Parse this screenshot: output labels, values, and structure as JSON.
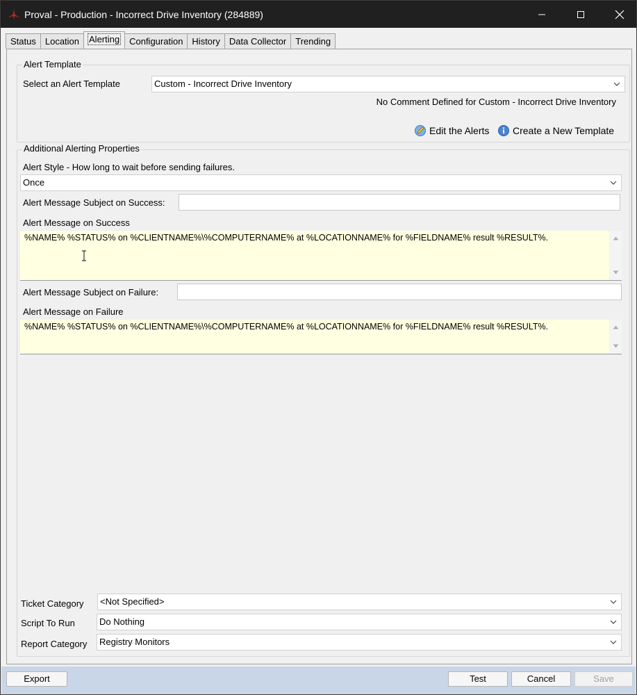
{
  "window": {
    "title": "Proval - Production - Incorrect Drive Inventory (284889)",
    "accent": "#c0281c"
  },
  "tabs": [
    {
      "label": "Status"
    },
    {
      "label": "Location"
    },
    {
      "label": "Alerting",
      "active": true
    },
    {
      "label": "Configuration"
    },
    {
      "label": "History"
    },
    {
      "label": "Data Collector"
    },
    {
      "label": "Trending"
    }
  ],
  "alert_template": {
    "group_label": "Alert Template",
    "select_label": "Select an Alert Template",
    "selected": "Custom - Incorrect Drive Inventory",
    "comment": "No Comment Defined for Custom - Incorrect Drive Inventory",
    "edit_alerts": "Edit the Alerts",
    "create_template": "Create a New Template"
  },
  "additional": {
    "group_label": "Additional Alerting Properties",
    "alert_style_label": "Alert Style - How long to wait before sending failures.",
    "alert_style_value": "Once",
    "success_subject_label": "Alert Message Subject on Success:",
    "success_subject_value": "",
    "success_message_label": "Alert Message on Success",
    "success_message": "%NAME% %STATUS% on %CLIENTNAME%\\%COMPUTERNAME% at %LOCATIONNAME% for %FIELDNAME% result %RESULT%.",
    "failure_subject_label": "Alert Message Subject on Failure:",
    "failure_subject_value": "",
    "failure_message_label": "Alert Message on Failure",
    "failure_message": "%NAME% %STATUS% on %CLIENTNAME%\\%COMPUTERNAME% at %LOCATIONNAME% for %FIELDNAME% result %RESULT%."
  },
  "bottom_fields": {
    "ticket_category_label": "Ticket Category",
    "ticket_category_value": "<Not Specified>",
    "script_label": "Script To Run",
    "script_value": "Do Nothing",
    "report_category_label": "Report Category",
    "report_category_value": "Registry Monitors"
  },
  "footer": {
    "export": "Export",
    "test": "Test",
    "cancel": "Cancel",
    "save": "Save"
  }
}
